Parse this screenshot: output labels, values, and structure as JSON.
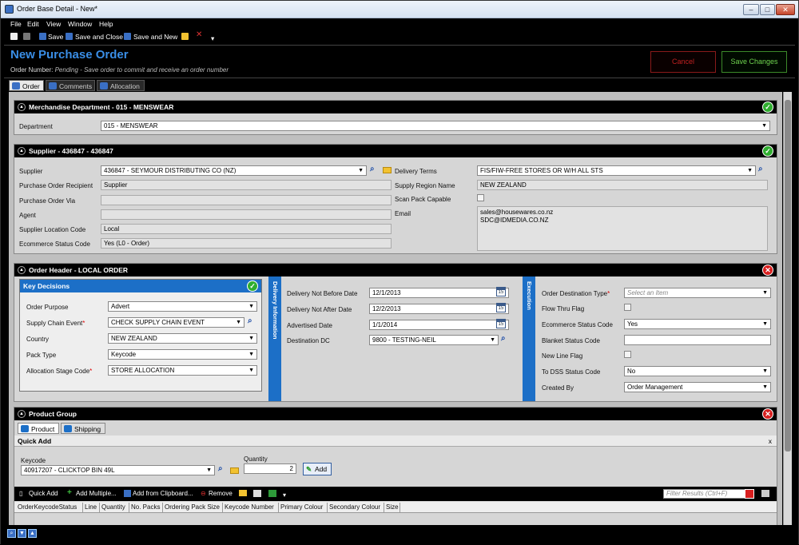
{
  "window": {
    "title": "Order Base Detail - New*"
  },
  "menu": [
    "File",
    "Edit",
    "View",
    "Window",
    "Help"
  ],
  "toolbar": {
    "save": "Save",
    "save_close": "Save and Close",
    "save_new": "Save and New"
  },
  "header": {
    "title": "New Purchase Order",
    "order_number_label": "Order Number:",
    "order_number_status": "Pending - Save order to commit and receive an order number",
    "cancel": "Cancel",
    "save_changes": "Save Changes"
  },
  "tabs": [
    "Order",
    "Comments",
    "Allocation"
  ],
  "merch": {
    "title": "Merchandise Department - 015 - MENSWEAR",
    "department_label": "Department",
    "department_value": "015 - MENSWEAR"
  },
  "supplier": {
    "title": "Supplier - 436847 - 436847",
    "supplier_label": "Supplier",
    "supplier_value": "436847 - SEYMOUR DISTRIBUTING CO (NZ)",
    "recipient_label": "Purchase Order Recipient",
    "recipient_value": "Supplier",
    "via_label": "Purchase Order Via",
    "via_value": "",
    "agent_label": "Agent",
    "agent_value": "",
    "loc_label": "Supplier Location Code",
    "loc_value": "Local",
    "ecom_label": "Ecommerce Status Code",
    "ecom_value": "Yes (L0 - Order)",
    "terms_label": "Delivery Terms",
    "terms_value": "FIS/FIW-FREE STORES OR W/H ALL STS",
    "region_label": "Supply Region Name",
    "region_value": "NEW ZEALAND",
    "scan_label": "Scan Pack Capable",
    "email_label": "Email",
    "email_1": "sales@housewares.co.nz",
    "email_2": "SDC@IDMEDIA.CO.NZ"
  },
  "order_header": {
    "title": "Order Header - LOCAL ORDER",
    "key_decisions": "Key Decisions",
    "purpose_label": "Order Purpose",
    "purpose_value": "Advert",
    "chain_label": "Supply Chain Event",
    "chain_value": "CHECK SUPPLY CHAIN EVENT",
    "country_label": "Country",
    "country_value": "NEW ZEALAND",
    "packtype_label": "Pack Type",
    "packtype_value": "Keycode",
    "alloc_label": "Allocation Stage Code",
    "alloc_value": "STORE ALLOCATION",
    "delivery_info": "Delivery Information",
    "dnb_label": "Delivery Not Before Date",
    "dnb_value": "12/1/2013",
    "dna_label": "Delivery Not After Date",
    "dna_value": "12/2/2013",
    "adv_label": "Advertised Date",
    "adv_value": "1/1/2014",
    "dc_label": "Destination DC",
    "dc_value": "9800 - TESTING-NEIL",
    "execution": "Execution",
    "desttype_label": "Order Destination Type",
    "desttype_placeholder": "Select an Item",
    "flowthru_label": "Flow Thru Flag",
    "ecom2_label": "Ecommerce Status Code",
    "ecom2_value": "Yes",
    "blanket_label": "Blanket Status Code",
    "blanket_value": "",
    "newline_label": "New Line Flag",
    "dss_label": "To DSS Status Code",
    "dss_value": "No",
    "created_label": "Created By",
    "created_value": "Order Management"
  },
  "product_group": {
    "title": "Product Group",
    "tabs": [
      "Product",
      "Shipping"
    ],
    "quick_add": "Quick Add",
    "close": "x",
    "keycode_label": "Keycode",
    "keycode_value": "40917207 - CLICKTOP BIN 49L",
    "quantity_label": "Quantity",
    "quantity_value": "2",
    "add": "Add",
    "grid_quick_add": "Quick Add",
    "add_multiple": "Add Multiple...",
    "add_clipboard": "Add from Clipboard...",
    "remove": "Remove",
    "filter_placeholder": "Filter Results (Ctrl+F)",
    "columns": [
      "OrderKeycodeStatus",
      "Line",
      "Quantity",
      "No. Packs",
      "Ordering Pack Size",
      "Keycode Number",
      "Primary Colour",
      "Secondary Colour",
      "Size"
    ]
  },
  "colors": {
    "accent_blue": "#1c6fc7",
    "title_blue": "#3a8ee6",
    "ok_green": "#2fae2f",
    "error_red": "#d81f1f"
  }
}
